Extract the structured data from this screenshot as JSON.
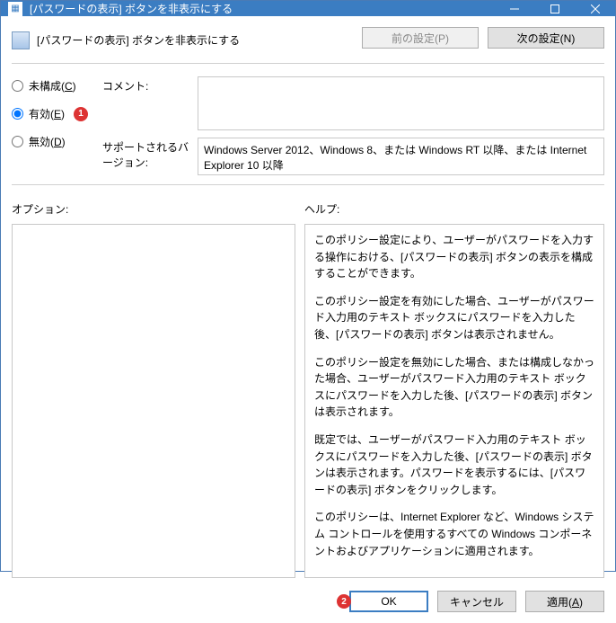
{
  "window": {
    "title": "[パスワードの表示] ボタンを非表示にする"
  },
  "header": {
    "title": "[パスワードの表示] ボタンを非表示にする"
  },
  "nav": {
    "prev": "前の設定(P)",
    "next": "次の設定(N)"
  },
  "radios": {
    "not_configured": "未構成(C)",
    "enabled": "有効(E)",
    "disabled": "無効(D)",
    "selected": "enabled"
  },
  "fields": {
    "comment_label": "コメント:",
    "comment_value": "",
    "version_label": "サポートされるバージョン:",
    "version_value": "Windows Server 2012、Windows 8、または Windows RT 以降、または Internet Explorer 10 以降"
  },
  "panels": {
    "options_label": "オプション:",
    "help_label": "ヘルプ:",
    "help_paragraphs": [
      "このポリシー設定により、ユーザーがパスワードを入力する操作における、[パスワードの表示] ボタンの表示を構成することができます。",
      "このポリシー設定を有効にした場合、ユーザーがパスワード入力用のテキスト ボックスにパスワードを入力した後、[パスワードの表示] ボタンは表示されません。",
      "このポリシー設定を無効にした場合、または構成しなかった場合、ユーザーがパスワード入力用のテキスト ボックスにパスワードを入力した後、[パスワードの表示] ボタンは表示されます。",
      "既定では、ユーザーがパスワード入力用のテキスト ボックスにパスワードを入力した後、[パスワードの表示] ボタンは表示されます。パスワードを表示するには、[パスワードの表示] ボタンをクリックします。",
      "このポリシーは、Internet Explorer など、Windows システム コントロールを使用するすべての Windows コンポーネントおよびアプリケーションに適用されます。"
    ]
  },
  "footer": {
    "ok": "OK",
    "cancel": "キャンセル",
    "apply": "適用(A)"
  },
  "annotations": {
    "badge1": "1",
    "badge2": "2"
  }
}
